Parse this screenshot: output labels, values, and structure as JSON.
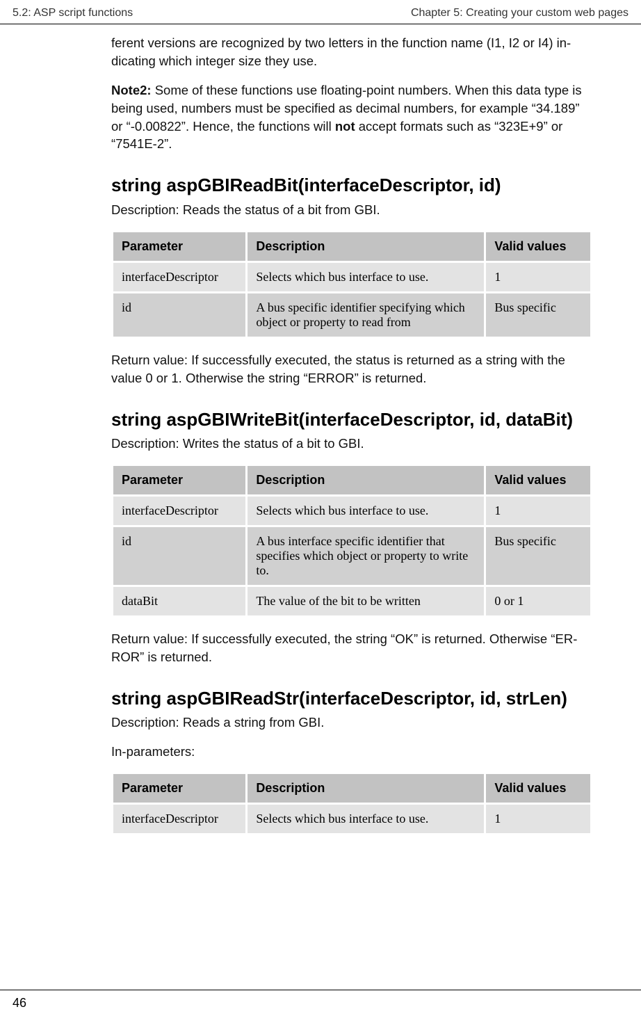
{
  "header": {
    "left": "5.2: ASP script functions",
    "right": "Chapter 5: Creating your custom web pages"
  },
  "intro": {
    "p1": "ferent versions are recognized by two letters in the function name (I1, I2 or I4) in­dicating which integer size they use.",
    "note2_label": "Note2:",
    "note2_body_a": " Some of these functions use floating-point numbers. When this data type is being used, numbers must be specified as decimal numbers, for example “34.189” or “-0.00822”. Hence, the functions will ",
    "note2_bold": "not",
    "note2_body_b": " accept formats such as “323E+9” or “7541E-2”."
  },
  "table_headers": {
    "param": "Parameter",
    "desc": "Description",
    "valid": "Valid val­ues"
  },
  "func1": {
    "title": "string aspGBIReadBit(interfaceDescriptor, id)",
    "desc": "Description: Reads the status of a bit from GBI.",
    "rows": [
      {
        "p": "interfaceDescriptor",
        "d": "Selects which bus interface to use.",
        "v": "1"
      },
      {
        "p": "id",
        "d": "A bus specific identifier specifying which object or property to read from",
        "v": "Bus specific"
      }
    ],
    "return": "Return value: If successfully executed, the status is returned as a string with the value 0 or 1. Otherwise the string “ERROR” is returned."
  },
  "func2": {
    "title": "string aspGBIWriteBit(interfaceDescriptor, id, dataBit)",
    "desc": "Description: Writes the status of a bit to GBI.",
    "rows": [
      {
        "p": "interfaceDescriptor",
        "d": "Selects which bus interface to use.",
        "v": "1"
      },
      {
        "p": "id",
        "d": "A bus interface specific identifier that specifies which object or property to write to.",
        "v": "Bus specific"
      },
      {
        "p": "dataBit",
        "d": "The value of the bit to be written",
        "v": "0 or 1"
      }
    ],
    "return": "Return value: If successfully executed, the string “OK” is returned. Otherwise “ER­ROR” is returned."
  },
  "func3": {
    "title": "string aspGBIReadStr(interfaceDescriptor, id, strLen)",
    "desc": "Description: Reads a string from GBI.",
    "inparams": "In-parameters:",
    "rows": [
      {
        "p": "interfaceDescriptor",
        "d": "Selects which bus interface to use.",
        "v": "1"
      }
    ]
  },
  "footer": {
    "page": "46"
  }
}
